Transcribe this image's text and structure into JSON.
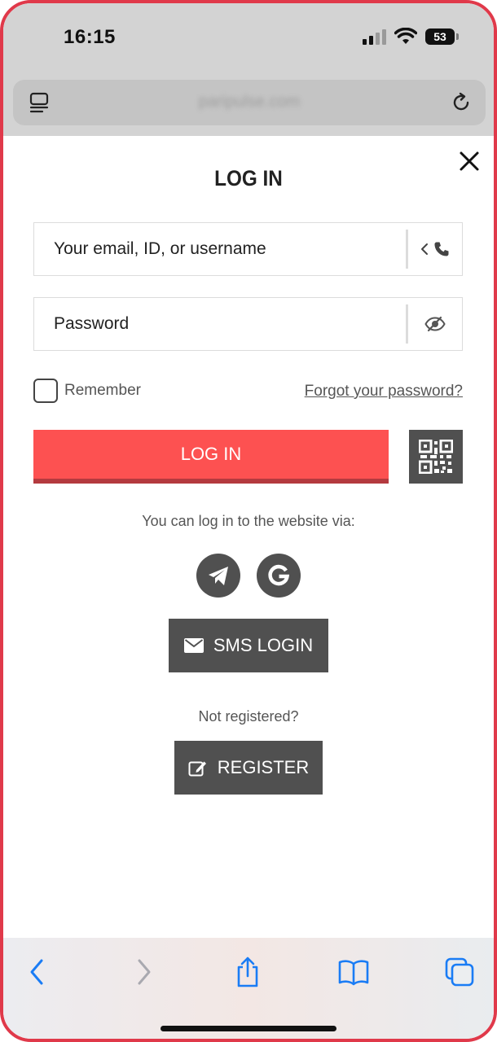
{
  "status_bar": {
    "time": "16:15",
    "battery": "53"
  },
  "browser": {
    "url": "paripulse.com"
  },
  "modal": {
    "title": "LOG IN",
    "login_field": {
      "placeholder": "Your email, ID, or username"
    },
    "password_field": {
      "placeholder": "Password"
    },
    "remember_label": "Remember",
    "forgot_link": "Forgot your password?",
    "login_button": "LOG IN",
    "via_text": "You can log in to the website via:",
    "social": [
      "telegram-icon",
      "google-icon"
    ],
    "sms_button": "SMS LOGIN",
    "not_registered": "Not registered?",
    "register_button": "REGISTER"
  },
  "colors": {
    "accent_red": "#fd5151",
    "accent_red_shadow": "#b43a3f",
    "dark_button": "#505050",
    "ios_blue": "#1a7cf5"
  }
}
